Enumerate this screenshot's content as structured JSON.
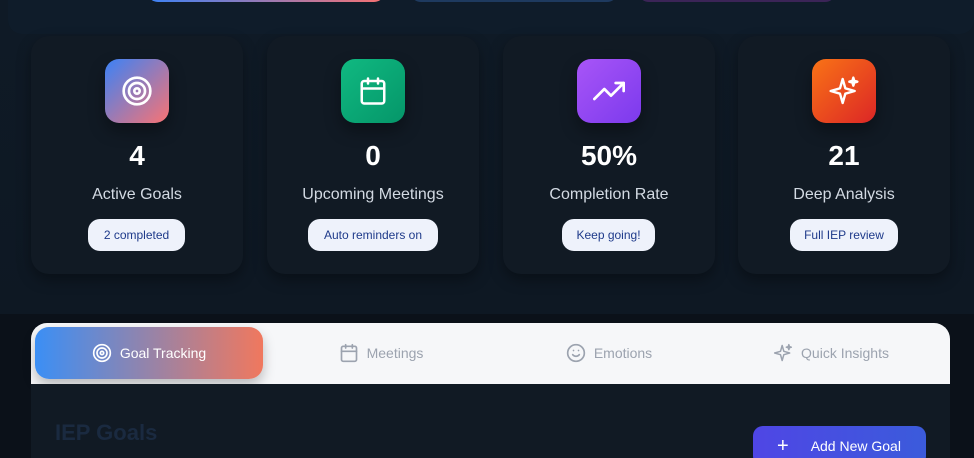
{
  "stats": [
    {
      "value": "4",
      "label": "Active Goals",
      "badge": "2 completed",
      "icon": "target-icon"
    },
    {
      "value": "0",
      "label": "Upcoming Meetings",
      "badge": "Auto reminders on",
      "icon": "calendar-icon"
    },
    {
      "value": "50%",
      "label": "Completion Rate",
      "badge": "Keep going!",
      "icon": "trending-up-icon"
    },
    {
      "value": "21",
      "label": "Deep Analysis",
      "badge": "Full IEP review",
      "icon": "sparkles-icon"
    }
  ],
  "tabs": [
    {
      "label": "Goal Tracking",
      "icon": "target-icon",
      "active": true
    },
    {
      "label": "Meetings",
      "icon": "calendar-icon",
      "active": false
    },
    {
      "label": "Emotions",
      "icon": "smile-icon",
      "active": false
    },
    {
      "label": "Quick Insights",
      "icon": "sparkles-icon",
      "active": false
    }
  ],
  "section": {
    "title": "IEP Goals",
    "add_button": "Add New Goal"
  },
  "colors": {
    "background": "#0b1119",
    "card": "#111a24",
    "accent_blue": "#3b82f6",
    "accent_coral": "#f87171",
    "green": "#10b981",
    "purple": "#a855f7",
    "orange": "#f97316"
  }
}
